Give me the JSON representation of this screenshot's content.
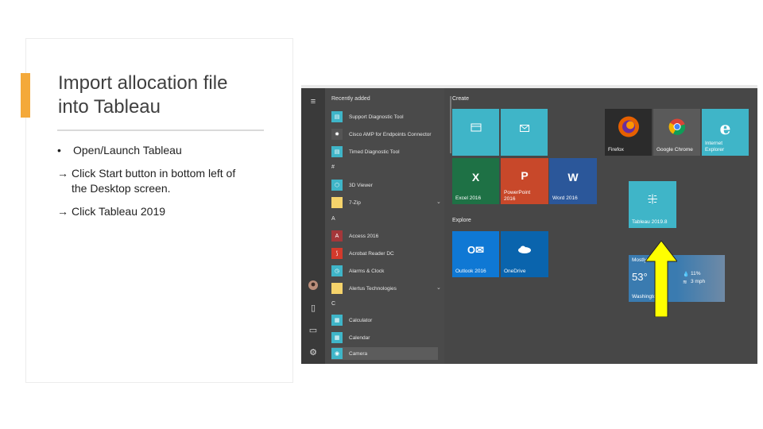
{
  "slide": {
    "title_line1": "Import allocation file",
    "title_line2": "into Tableau",
    "bullets": [
      {
        "marker": "•",
        "text": "Open/Launch Tableau"
      },
      {
        "marker": "→",
        "text": "Click Start button in bottom left of",
        "continuation": "the Desktop screen."
      },
      {
        "marker": "→",
        "text": "Click Tableau 2019"
      }
    ]
  },
  "start_menu": {
    "section_recent": "Recently added",
    "recent": [
      "Support Diagnostic Tool",
      "Cisco AMP for Endpoints Connector",
      "Timed Diagnostic Tool"
    ],
    "section_hash": "#",
    "hash_apps": [
      "3D Viewer",
      "7-Zip"
    ],
    "section_a": "A",
    "a_apps": [
      "Access 2016",
      "Acrobat Reader DC",
      "Alarms & Clock",
      "Alertus Technologies"
    ],
    "section_c": "C",
    "c_apps": [
      "Calculator",
      "Calendar",
      "Camera"
    ],
    "group_create": "Create",
    "group_explore": "Explore",
    "tiles": {
      "excel": "Excel 2016",
      "powerpoint": "PowerPoint 2016",
      "word": "Word 2016",
      "outlook": "Outlook 2016",
      "onedrive": "OneDrive",
      "firefox": "Firefox",
      "chrome": "Google Chrome",
      "ie": "Internet Explorer",
      "tableau": "Tableau 2019.8"
    },
    "weather": {
      "temp": "53°",
      "precip": "11%",
      "wind": "3 mph",
      "label_top": "Mostly",
      "label_bottom": "Washington"
    }
  },
  "colors": {
    "accent": "#f4a93a",
    "tile_blue": "#3fb5c8",
    "excel": "#1e7145",
    "powerpoint": "#c8482a",
    "word": "#2b579a",
    "outlook": "#0f78d4",
    "arrow": "#ffff00"
  }
}
